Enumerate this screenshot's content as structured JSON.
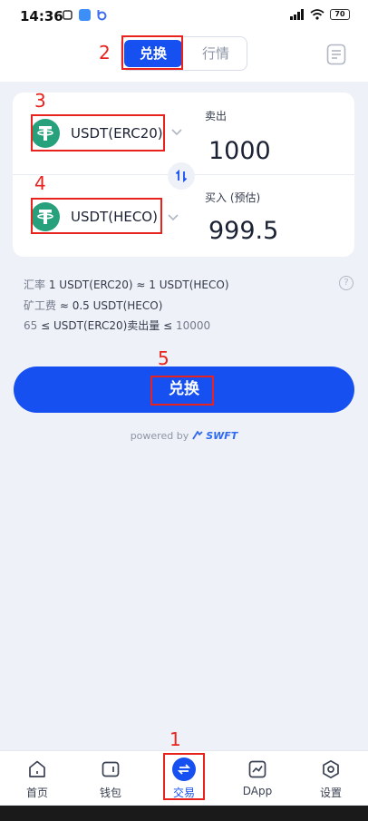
{
  "status_bar": {
    "time": "14:36",
    "battery": "70"
  },
  "header": {
    "tabs": [
      {
        "label": "兑换",
        "active": true
      },
      {
        "label": "行情",
        "active": false
      }
    ]
  },
  "swap": {
    "from_token": "USDT(ERC20)",
    "to_token": "USDT(HECO)",
    "sell_label": "卖出",
    "sell_value": "1000",
    "buy_label": "买入 (预估)",
    "buy_value": "999.5"
  },
  "info": {
    "rate_label": "汇率",
    "rate_value": "1 USDT(ERC20) ≈ 1 USDT(HECO)",
    "fee_label": "矿工费",
    "fee_value": "≈ 0.5  USDT(HECO)",
    "limit_min": "65",
    "limit_text": "≤ USDT(ERC20)卖出量 ≤",
    "limit_max": "10000"
  },
  "main_button": {
    "label": "兑换"
  },
  "powered": {
    "prefix": "powered by",
    "brand": "SWFT"
  },
  "annotations": [
    "1",
    "2",
    "3",
    "4",
    "5"
  ],
  "tabbar": {
    "items": [
      "首页",
      "钱包",
      "交易",
      "DApp",
      "设置"
    ]
  },
  "colors": {
    "accent": "#1750f0",
    "tether": "#26a17b",
    "annotation": "#e8221c"
  }
}
